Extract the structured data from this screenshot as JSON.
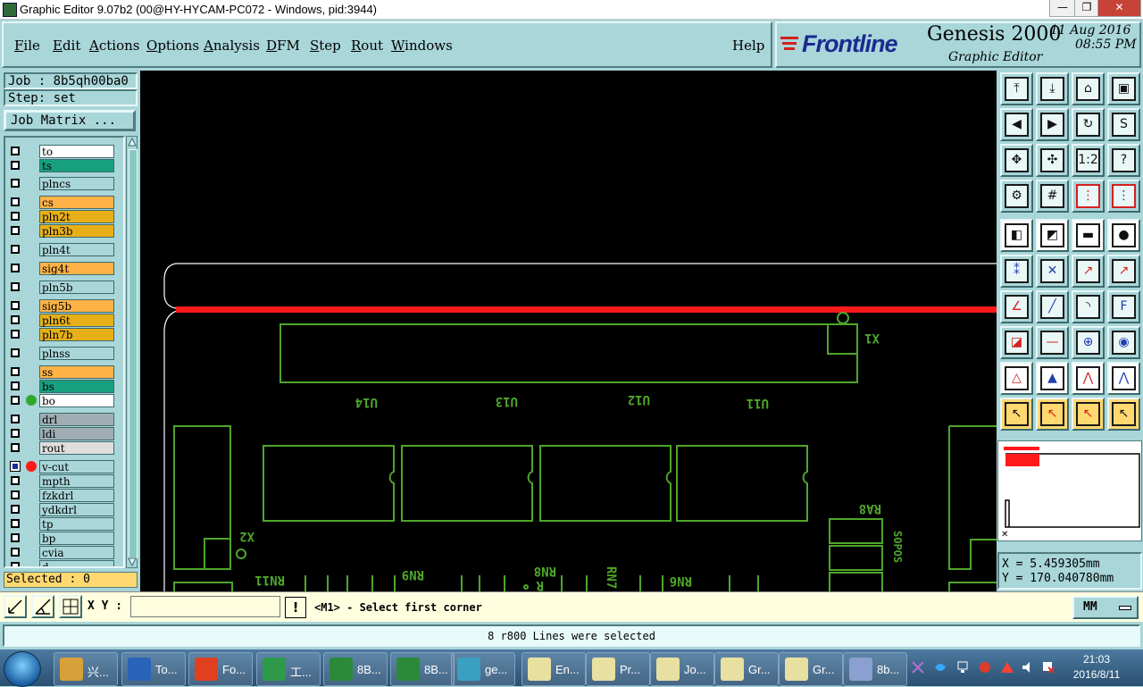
{
  "window": {
    "title": "Graphic Editor 9.07b2 (00@HY-HYCAM-PC072 - Windows, pid:3944)",
    "minimize": "—",
    "maximize": "❐",
    "close": "✕"
  },
  "menu": {
    "items": [
      {
        "key": "F",
        "rest": "ile"
      },
      {
        "key": "E",
        "rest": "dit"
      },
      {
        "key": "A",
        "rest": "ctions"
      },
      {
        "key": "O",
        "rest": "ptions"
      },
      {
        "key": "A",
        "rest": "nalysis"
      },
      {
        "key": "D",
        "rest": "FM"
      },
      {
        "key": "S",
        "rest": "tep"
      },
      {
        "key": "R",
        "rest": "out"
      },
      {
        "key": "W",
        "rest": "indows"
      }
    ],
    "help": "Help"
  },
  "brand": {
    "logo": "Frontline",
    "product": "Genesis 2000",
    "subtitle": "Graphic Editor",
    "date": "11 Aug 2016",
    "time": "08:55 PM"
  },
  "job": {
    "job_label": "Job : 8b5qh00ba0",
    "step_label": "Step: set",
    "matrix_button": "Job Matrix ..."
  },
  "layers": [
    {
      "name": "to",
      "bg": "#ffffff",
      "checked": false,
      "dot": null
    },
    {
      "name": "ts",
      "bg": "#17a07e",
      "checked": false,
      "dot": null
    },
    {
      "name": "plncs",
      "bg": "#a9d6d9",
      "checked": false,
      "dot": null
    },
    {
      "name": "cs",
      "bg": "#ffb347",
      "checked": false,
      "dot": null
    },
    {
      "name": "pln2t",
      "bg": "#e8b018",
      "checked": false,
      "dot": null
    },
    {
      "name": "pln3b",
      "bg": "#e8b018",
      "checked": false,
      "dot": null
    },
    {
      "name": "pln4t",
      "bg": "#a9d6d9",
      "checked": false,
      "dot": null
    },
    {
      "name": "sig4t",
      "bg": "#ffb347",
      "checked": false,
      "dot": null
    },
    {
      "name": "pln5b",
      "bg": "#a9d6d9",
      "checked": false,
      "dot": null
    },
    {
      "name": "sig5b",
      "bg": "#ffb347",
      "checked": false,
      "dot": null
    },
    {
      "name": "pln6t",
      "bg": "#e8b018",
      "checked": false,
      "dot": null
    },
    {
      "name": "pln7b",
      "bg": "#e8b018",
      "checked": false,
      "dot": null
    },
    {
      "name": "plnss",
      "bg": "#a9d6d9",
      "checked": false,
      "dot": null
    },
    {
      "name": "ss",
      "bg": "#ffb347",
      "checked": false,
      "dot": null
    },
    {
      "name": "bs",
      "bg": "#17a07e",
      "checked": false,
      "dot": null
    },
    {
      "name": "bo",
      "bg": "#ffffff",
      "checked": false,
      "dot": "#2fa82f"
    },
    {
      "name": "drl",
      "bg": "#a0aeb4",
      "checked": false,
      "dot": null
    },
    {
      "name": "ldi",
      "bg": "#a0aeb4",
      "checked": false,
      "dot": null
    },
    {
      "name": "rout",
      "bg": "#dedede",
      "checked": false,
      "dot": null
    },
    {
      "name": "v-cut",
      "bg": "#a9d6d9",
      "checked": true,
      "dot": "#ff1a1a"
    },
    {
      "name": "mpth",
      "bg": "#a9d6d9",
      "checked": false,
      "dot": null
    },
    {
      "name": "fzkdrl",
      "bg": "#a9d6d9",
      "checked": false,
      "dot": null
    },
    {
      "name": "ydkdrl",
      "bg": "#a9d6d9",
      "checked": false,
      "dot": null
    },
    {
      "name": "tp",
      "bg": "#a9d6d9",
      "checked": false,
      "dot": null
    },
    {
      "name": "bp",
      "bg": "#a9d6d9",
      "checked": false,
      "dot": null
    },
    {
      "name": "cvia",
      "bg": "#a9d6d9",
      "checked": false,
      "dot": null
    },
    {
      "name": "d",
      "bg": "#a9d6d9",
      "checked": false,
      "dot": null
    }
  ],
  "selected_count": "Selected : 0",
  "canvas_labels": {
    "u14": "U14",
    "u13": "U13",
    "u12": "U12",
    "u11": "U11",
    "x1": "X1",
    "x2": "X2",
    "ra8": "RA8",
    "rn11": "RN11",
    "rn9": "RN9",
    "rn8": "RN8",
    "rn6": "RN6",
    "rn7": "RN7",
    "r": "R",
    "sopos": "SOPOS"
  },
  "colors": {
    "canvas_bg": "#000000",
    "board_outline": "#ffffff",
    "silkscreen": "#4fa62a",
    "vcut": "#ff1a1a"
  },
  "toolbar_icons": [
    "zoom-home-icon",
    "zoom-page-icon",
    "home-icon",
    "fit-window-icon",
    "pan-left-icon",
    "pan-right-icon",
    "redraw-icon",
    "snap-icon",
    "zoom-in-icon",
    "zoom-out-icon",
    "ratio-icon",
    "help-icon",
    "measure-icon",
    "grid-icon",
    "net-red-icon",
    "net-blue-icon",
    "film-icon",
    "shape-icon",
    "ruler-icon",
    "pad-icon",
    "connect-icon",
    "cross-icon",
    "edge-icon",
    "move-icon",
    "angle-icon",
    "line-icon",
    "arc-icon",
    "text-icon",
    "snap-point-icon",
    "split-icon",
    "align-icon",
    "fill-icon",
    "triangle-red-icon",
    "triangle-blue-icon",
    "arch-icon",
    "arch-line-icon",
    "select-arrow-icon",
    "select-box-icon",
    "select-circle-icon",
    "select-path-icon"
  ],
  "toolbar_text": {
    "ratio": "1:2",
    "help": "?"
  },
  "coords": {
    "x": "X  =  5.459305mm",
    "y": "Y  =  170.040780mm"
  },
  "command": {
    "xy_label": "X Y :",
    "xy_value": "",
    "prompt_icon": "!",
    "prompt": "<M1> - Select first corner",
    "units": "MM"
  },
  "status": "8 r800 Lines were selected",
  "taskbar": {
    "items": [
      {
        "label": "兴...",
        "color": "#d8a03a"
      },
      {
        "label": "To...",
        "color": "#2a64b8"
      },
      {
        "label": "Fo...",
        "color": "#e04020"
      },
      {
        "label": "工...",
        "color": "#2e9a4a"
      },
      {
        "label": "8B...",
        "color": "#2a8a3a"
      },
      {
        "label": "8B...",
        "color": "#2a8a3a"
      },
      {
        "label": "ge...",
        "color": "#3aa0c0"
      },
      {
        "label": "En...",
        "color": "#e8e0a0"
      },
      {
        "label": "Pr...",
        "color": "#e8e0a0"
      },
      {
        "label": "Jo...",
        "color": "#e8e0a0"
      },
      {
        "label": "Gr...",
        "color": "#e8e0a0"
      },
      {
        "label": "Gr...",
        "color": "#e8e0a0"
      },
      {
        "label": "8b...",
        "color": "#8aa0d0"
      }
    ],
    "time": "21:03",
    "date": "2016/8/11"
  }
}
